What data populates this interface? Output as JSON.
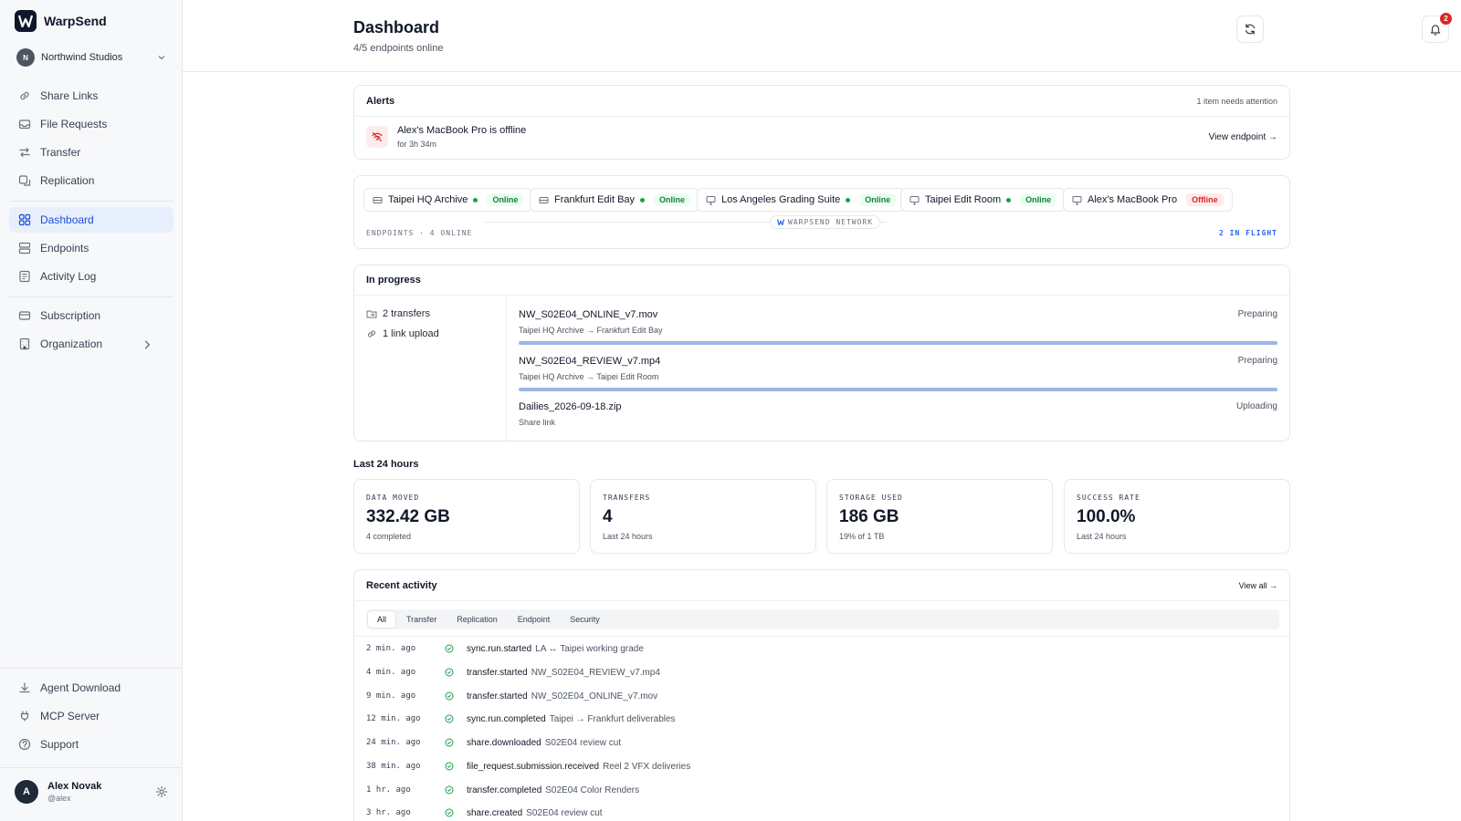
{
  "app": {
    "name": "WarpSend"
  },
  "org": {
    "initial": "N",
    "name": "Northwind Studios"
  },
  "nav": {
    "share_links": "Share Links",
    "file_requests": "File Requests",
    "transfer": "Transfer",
    "replication": "Replication",
    "dashboard": "Dashboard",
    "endpoints": "Endpoints",
    "activity_log": "Activity Log",
    "subscription": "Subscription",
    "organization": "Organization",
    "agent_download": "Agent Download",
    "mcp_server": "MCP Server",
    "support": "Support"
  },
  "user": {
    "initial": "A",
    "name": "Alex Novak",
    "handle": "@alex"
  },
  "header": {
    "title": "Dashboard",
    "subtitle": "4/5 endpoints online",
    "notifications": "2"
  },
  "alerts": {
    "title": "Alerts",
    "count": "1 item needs attention",
    "item": {
      "title": "Alex's MacBook Pro is offline",
      "duration": "for 3h 34m",
      "action": "View endpoint →"
    }
  },
  "network": {
    "endpoints": [
      {
        "name": "Taipei HQ Archive",
        "status": "Online"
      },
      {
        "name": "Frankfurt Edit Bay",
        "status": "Online"
      },
      {
        "name": "Los Angeles Grading Suite",
        "status": "Online"
      },
      {
        "name": "Taipei Edit Room",
        "status": "Online"
      },
      {
        "name": "Alex's MacBook Pro",
        "status": "Offline"
      }
    ],
    "label": "WARPSEND NETWORK",
    "footer_left": "ENDPOINTS · 4 ONLINE",
    "footer_right": "2 IN FLIGHT"
  },
  "in_progress": {
    "title": "In progress",
    "transfers": "2 transfers",
    "uploads": "1 link upload",
    "items": [
      {
        "name": "NW_S02E04_ONLINE_v7.mov",
        "route": "Taipei HQ Archive → Frankfurt Edit Bay",
        "state": "Preparing",
        "progress": 1.0
      },
      {
        "name": "NW_S02E04_REVIEW_v7.mp4",
        "route": "Taipei HQ Archive → Taipei Edit Room",
        "state": "Preparing",
        "progress": 1.0
      },
      {
        "name": "Dailies_2026-09-18.zip",
        "route": "Share link",
        "state": "Uploading"
      }
    ]
  },
  "stats": {
    "section": "Last 24 hours",
    "cards": [
      {
        "label": "DATA MOVED",
        "value": "332.42 GB",
        "sub": "4 completed"
      },
      {
        "label": "TRANSFERS",
        "value": "4",
        "sub": "Last 24 hours"
      },
      {
        "label": "STORAGE USED",
        "value": "186 GB",
        "sub": "19% of 1 TB"
      },
      {
        "label": "SUCCESS RATE",
        "value": "100.0%",
        "sub": "Last 24 hours"
      }
    ]
  },
  "activity": {
    "title": "Recent activity",
    "view_all": "View all →",
    "tabs": [
      "All",
      "Transfer",
      "Replication",
      "Endpoint",
      "Security"
    ],
    "rows": [
      {
        "time": "2 min. ago",
        "event": "sync.run.started",
        "desc": "LA ↔ Taipei working grade"
      },
      {
        "time": "4 min. ago",
        "event": "transfer.started",
        "desc": "NW_S02E04_REVIEW_v7.mp4"
      },
      {
        "time": "9 min. ago",
        "event": "transfer.started",
        "desc": "NW_S02E04_ONLINE_v7.mov"
      },
      {
        "time": "12 min. ago",
        "event": "sync.run.completed",
        "desc": "Taipei → Frankfurt deliverables"
      },
      {
        "time": "24 min. ago",
        "event": "share.downloaded",
        "desc": "S02E04 review cut"
      },
      {
        "time": "38 min. ago",
        "event": "file_request.submission.received",
        "desc": "Reel 2 VFX deliveries"
      },
      {
        "time": "1 hr. ago",
        "event": "transfer.completed",
        "desc": "S02E04 Color Renders"
      },
      {
        "time": "3 hr. ago",
        "event": "share.created",
        "desc": "S02E04 review cut"
      }
    ]
  },
  "colors": {
    "accent": "#1d4ed8",
    "online": "#16a34a",
    "offline": "#dc2626"
  }
}
